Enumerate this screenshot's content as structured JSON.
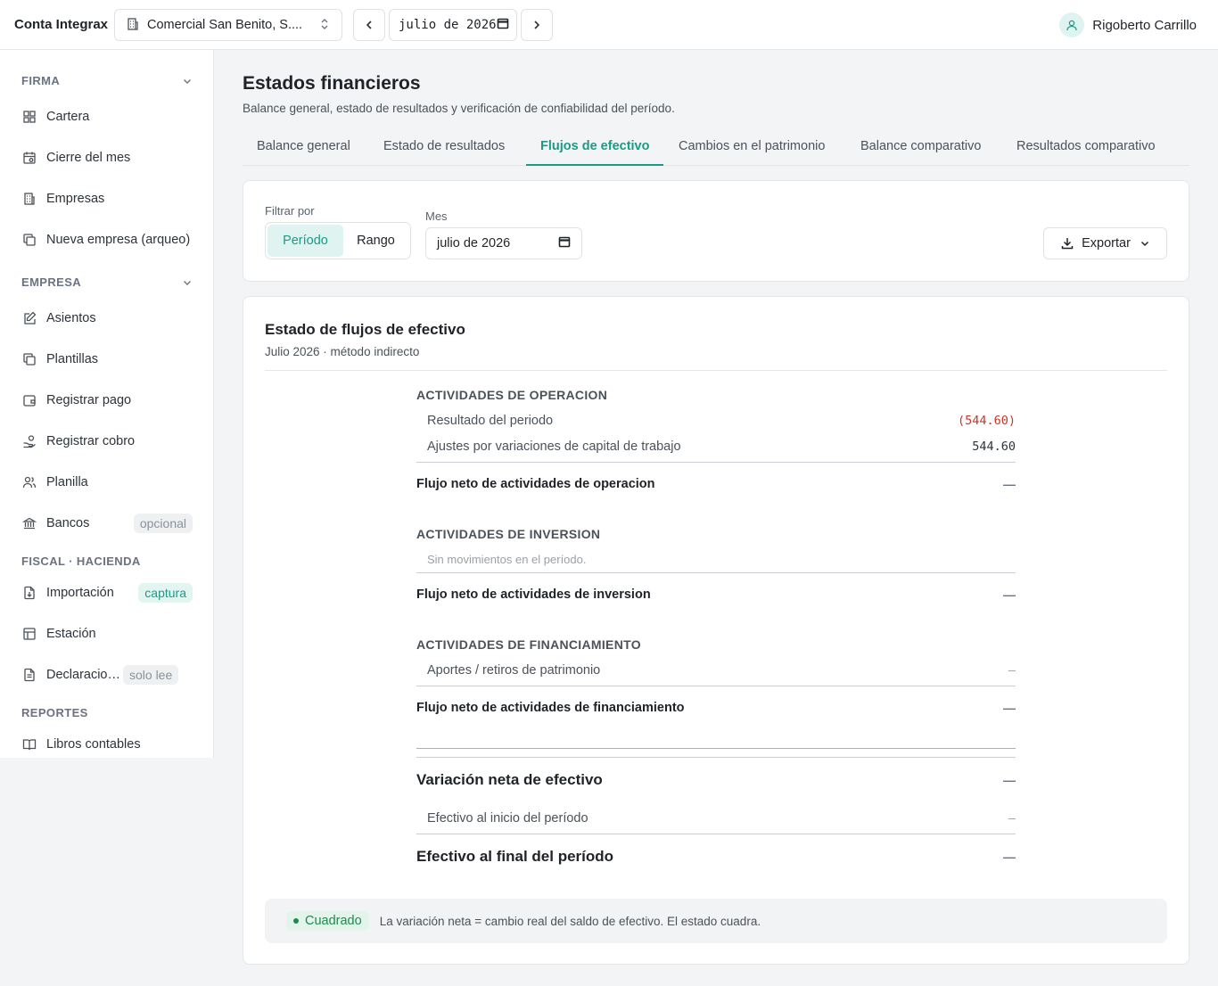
{
  "topbar": {
    "brand": "Conta Integrax",
    "company": "Comercial San Benito, S....",
    "month": "julio de 2026",
    "user_name": "Rigoberto Carrillo"
  },
  "sidebar": {
    "sections": [
      {
        "title": "FIRMA",
        "items": [
          {
            "label": "Cartera",
            "icon": "grid-icon"
          },
          {
            "label": "Cierre del mes",
            "icon": "calendar-icon"
          },
          {
            "label": "Empresas",
            "icon": "building-icon"
          },
          {
            "label": "Nueva empresa (arqueo)",
            "icon": "copy-icon"
          }
        ]
      },
      {
        "title": "EMPRESA",
        "items": [
          {
            "label": "Asientos",
            "icon": "edit-icon"
          },
          {
            "label": "Plantillas",
            "icon": "copy-icon"
          },
          {
            "label": "Registrar pago",
            "icon": "wallet-icon"
          },
          {
            "label": "Registrar cobro",
            "icon": "hand-coins-icon"
          },
          {
            "label": "Planilla",
            "icon": "users-icon"
          },
          {
            "label": "Bancos",
            "icon": "bank-icon",
            "badge": "opcional"
          }
        ]
      },
      {
        "title": "FISCAL · HACIENDA",
        "items": [
          {
            "label": "Importación",
            "icon": "file-import-icon",
            "badge": "captura"
          },
          {
            "label": "Estación",
            "icon": "table-icon"
          },
          {
            "label": "Declaraciones",
            "icon": "file-text-icon",
            "badge": "solo lee"
          }
        ]
      },
      {
        "title": "REPORTES",
        "items": [
          {
            "label": "Libros contables",
            "icon": "book-icon"
          }
        ]
      }
    ]
  },
  "page": {
    "title": "Estados financieros",
    "subtitle": "Balance general, estado de resultados y verificación de confiabilidad del período.",
    "tabs": [
      "Balance general",
      "Estado de resultados",
      "Flujos de efectivo",
      "Cambios en el patrimonio",
      "Balance comparativo",
      "Resultados comparativo"
    ],
    "active_tab": "Flujos de efectivo"
  },
  "filter": {
    "label": "Filtrar por",
    "options": [
      "Período",
      "Rango"
    ],
    "selected": "Período",
    "month_label": "Mes",
    "month_value": "julio de 2026",
    "export_label": "Exportar"
  },
  "statement": {
    "title": "Estado de flujos de efectivo",
    "subtitle": "Julio 2026 · método indirecto",
    "operating": {
      "heading": "ACTIVIDADES DE OPERACION",
      "lines": [
        {
          "label": "Resultado del periodo",
          "amount": "(544.60)"
        },
        {
          "label": "Ajustes por variaciones de capital de trabajo",
          "amount": "544.60"
        }
      ],
      "total_label": "Flujo neto de actividades de operacion",
      "total_amount": "—"
    },
    "investing": {
      "heading": "ACTIVIDADES DE INVERSION",
      "note": "Sin movimientos en el período.",
      "total_label": "Flujo neto de actividades de inversion",
      "total_amount": "—"
    },
    "financing": {
      "heading": "ACTIVIDADES DE FINANCIAMIENTO",
      "lines": [
        {
          "label": "Aportes / retiros de patrimonio",
          "amount": "—"
        }
      ],
      "total_label": "Flujo neto de actividades de financiamiento",
      "total_amount": "—"
    },
    "net_change_label": "Variación neta de efectivo",
    "net_change_amount": "—",
    "opening_label": "Efectivo al inicio del período",
    "opening_amount": "—",
    "closing_label": "Efectivo al final del período",
    "closing_amount": "—"
  },
  "status": {
    "badge": "Cuadrado",
    "message": "La variación neta = cambio real del saldo de efectivo. El estado cuadra."
  },
  "colors": {
    "accent": "#1c9a86",
    "negative": "#c0392b",
    "success": "#1e8a4f"
  }
}
